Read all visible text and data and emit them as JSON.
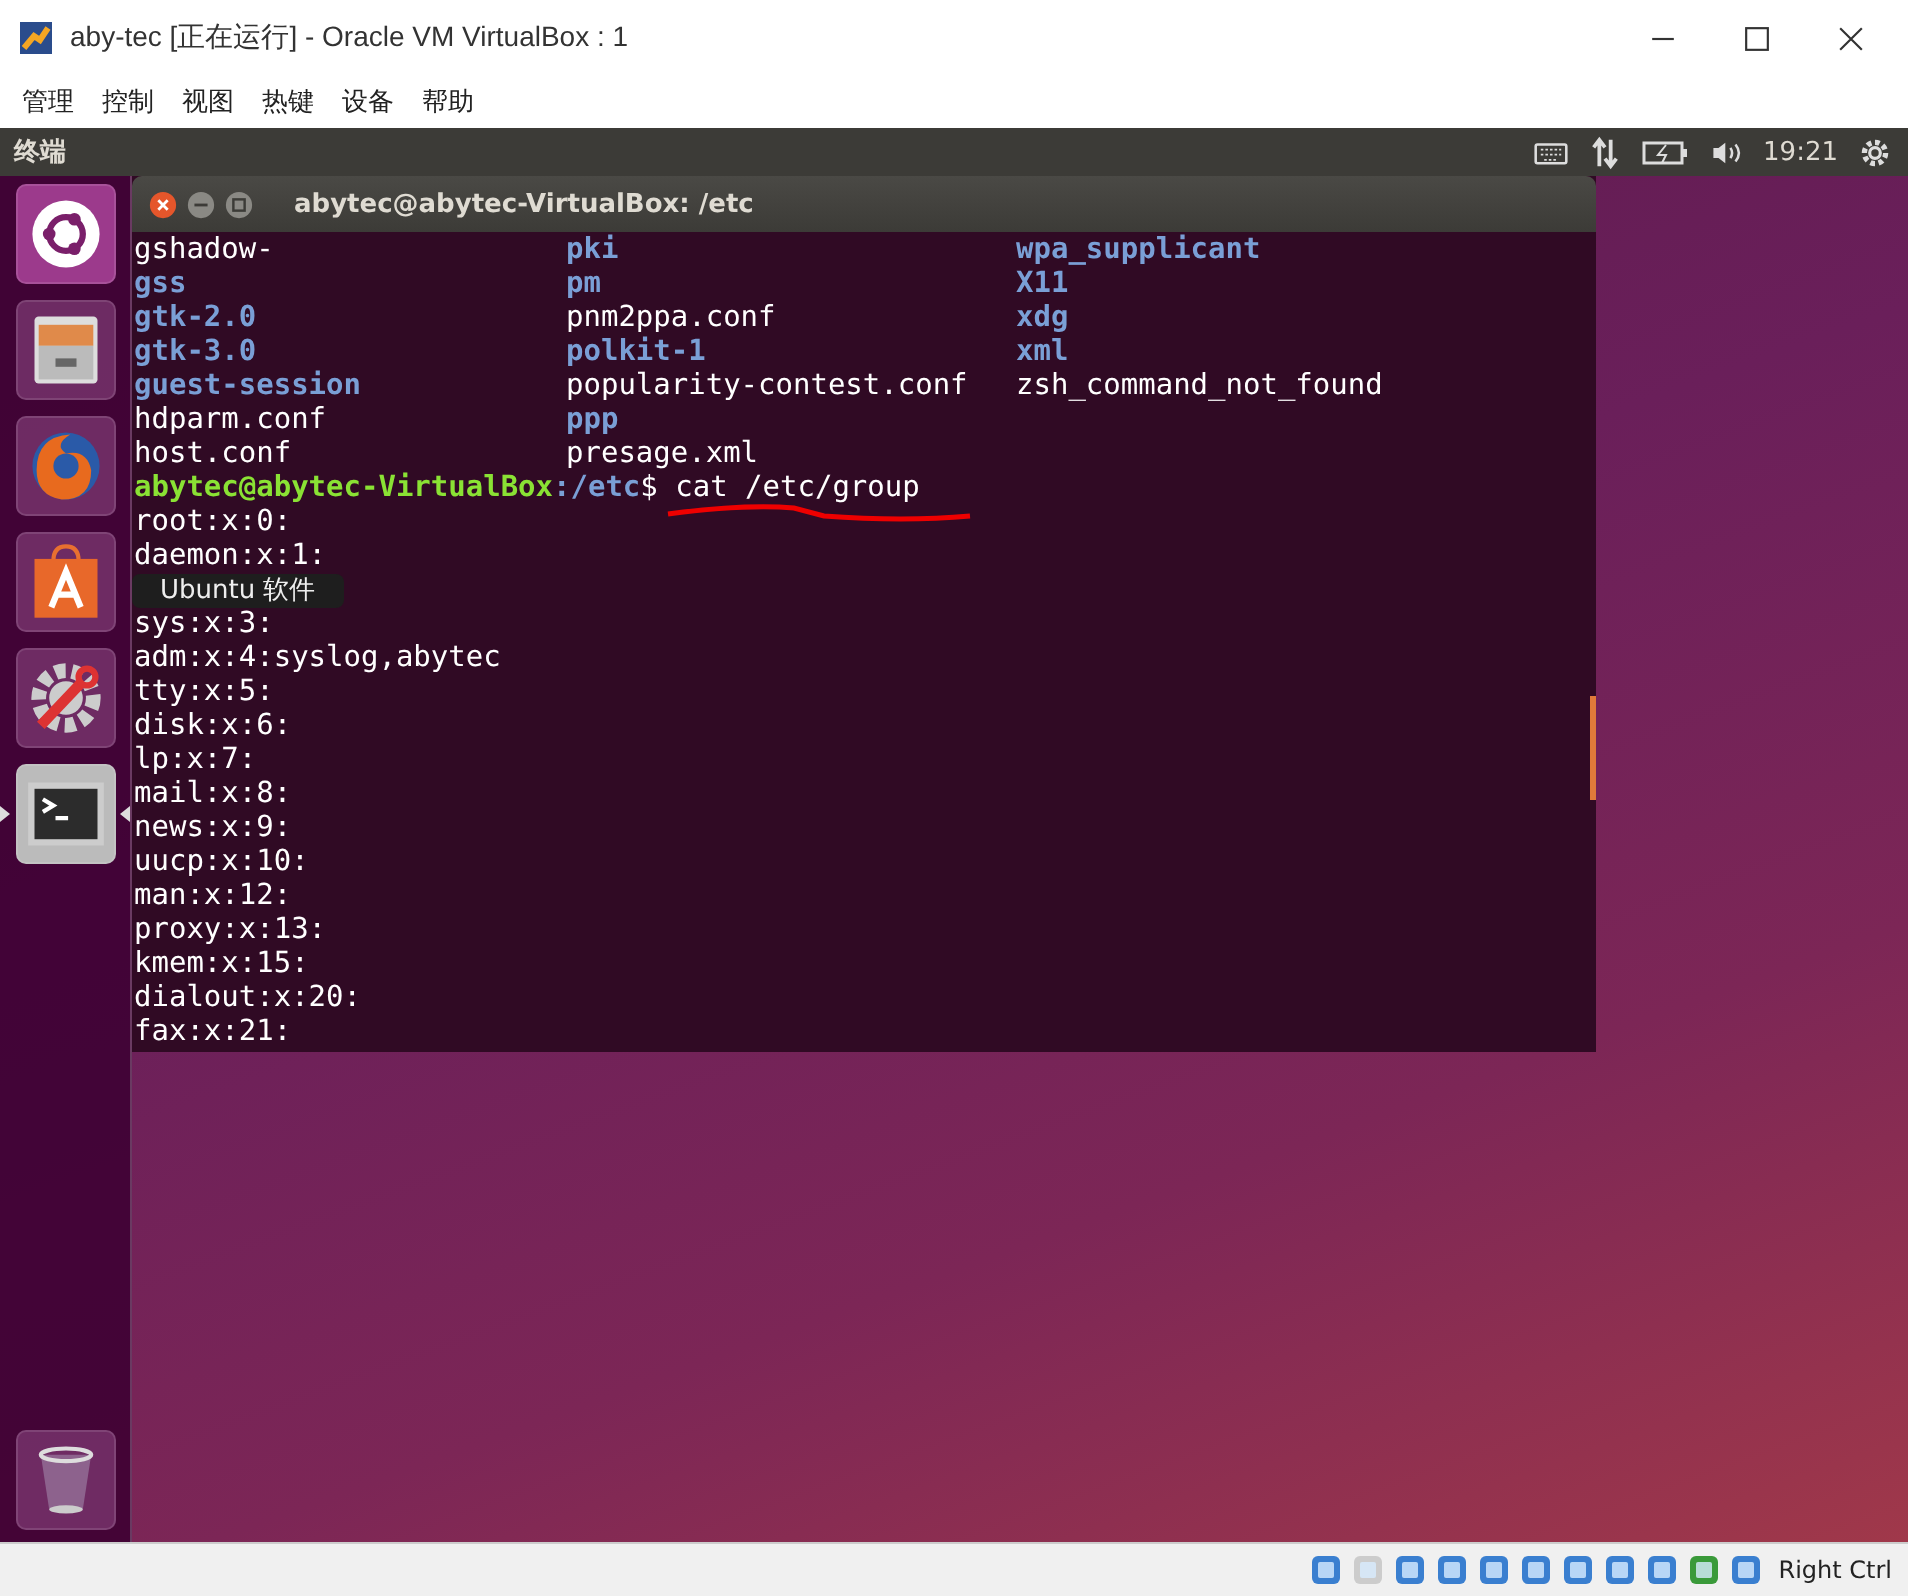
{
  "window": {
    "title": "aby-tec [正在运行] - Oracle VM VirtualBox : 1"
  },
  "menu": [
    "管理",
    "控制",
    "视图",
    "热键",
    "设备",
    "帮助"
  ],
  "top_panel": {
    "app_name": "终端",
    "clock": "19:21"
  },
  "launcher": {
    "items": [
      {
        "kind": "dash",
        "running": false
      },
      {
        "kind": "files",
        "running": false
      },
      {
        "kind": "browser",
        "running": false
      },
      {
        "kind": "software",
        "running": false
      },
      {
        "kind": "settings",
        "running": false
      },
      {
        "kind": "terminal",
        "running": true
      }
    ],
    "tooltip": "Ubuntu 软件"
  },
  "terminal": {
    "title": "abytec@abytec-VirtualBox: /etc",
    "listing": [
      [
        {
          "text": "gshadow-",
          "kind": "file"
        },
        {
          "text": "pki",
          "kind": "dir"
        },
        {
          "text": "wpa_supplicant",
          "kind": "dir"
        }
      ],
      [
        {
          "text": "gss",
          "kind": "dir"
        },
        {
          "text": "pm",
          "kind": "dir"
        },
        {
          "text": "X11",
          "kind": "dir"
        }
      ],
      [
        {
          "text": "gtk-2.0",
          "kind": "dir"
        },
        {
          "text": "pnm2ppa.conf",
          "kind": "file"
        },
        {
          "text": "xdg",
          "kind": "dir"
        }
      ],
      [
        {
          "text": "gtk-3.0",
          "kind": "dir"
        },
        {
          "text": "polkit-1",
          "kind": "dir"
        },
        {
          "text": "xml",
          "kind": "dir"
        }
      ],
      [
        {
          "text": "guest-session",
          "kind": "dir"
        },
        {
          "text": "popularity-contest.conf",
          "kind": "file"
        },
        {
          "text": "zsh_command_not_found",
          "kind": "file"
        }
      ],
      [
        {
          "text": "hdparm.conf",
          "kind": "file"
        },
        {
          "text": "ppp",
          "kind": "dir"
        }
      ],
      [
        {
          "text": "host.conf",
          "kind": "file"
        },
        {
          "text": "presage.xml",
          "kind": "file"
        }
      ]
    ],
    "prompt": {
      "user": "abytec@abytec-VirtualBox",
      "path": ":/etc",
      "command": "$ cat /etc/group"
    },
    "output": [
      "root:x:0:",
      "daemon:x:1:",
      "sys:x:3:",
      "adm:x:4:syslog,abytec",
      "tty:x:5:",
      "disk:x:6:",
      "lp:x:7:",
      "mail:x:8:",
      "news:x:9:",
      "uucp:x:10:",
      "man:x:12:",
      "proxy:x:13:",
      "kmem:x:15:",
      "dialout:x:20:",
      "fax:x:21:"
    ]
  },
  "status_bar": {
    "host_key": "Right Ctrl"
  }
}
